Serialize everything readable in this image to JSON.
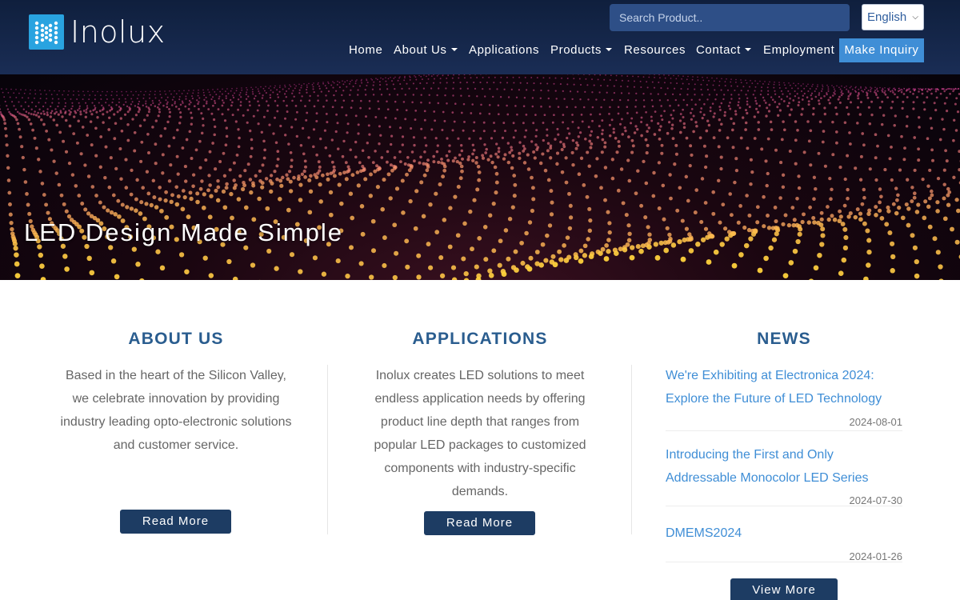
{
  "brand": {
    "name": "Inolux"
  },
  "search": {
    "placeholder": "Search Product.."
  },
  "language": {
    "selected": "English"
  },
  "nav": {
    "home": "Home",
    "about": "About Us",
    "applications": "Applications",
    "products": "Products",
    "resources": "Resources",
    "contact": "Contact",
    "employment": "Employment",
    "inquiry": "Make Inquiry"
  },
  "hero": {
    "title": "LED Design Made Simple"
  },
  "about": {
    "title": "ABOUT US",
    "text": "Based in the heart of the Silicon Valley, we celebrate innovation by providing industry leading opto-electronic solutions and customer service.",
    "button": "Read More"
  },
  "applications": {
    "title": "APPLICATIONS",
    "text": "Inolux creates LED solutions to meet endless application needs by offering product line depth that ranges from popular LED packages to customized components with industry-specific demands.",
    "button": "Read More"
  },
  "news": {
    "title": "NEWS",
    "items": [
      {
        "title": "We're Exhibiting at Electronica 2024: Explore the Future of LED Technology",
        "date": "2024-08-01"
      },
      {
        "title": "Introducing the First and Only Addressable Monocolor LED Series",
        "date": "2024-07-30"
      },
      {
        "title": "DMEMS2024",
        "date": "2024-01-26"
      }
    ],
    "button": "View More"
  },
  "colors": {
    "header": "#13244a",
    "accent": "#3f8ed6",
    "heading": "#2a5d8f",
    "button": "#1d3c63"
  },
  "icons": {
    "logo": "inolux-logo-icon"
  }
}
